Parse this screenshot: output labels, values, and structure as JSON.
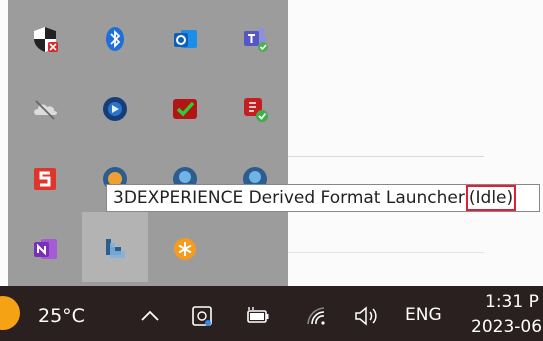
{
  "tooltip": {
    "app_name": "3DEXPERIENCE Derived Format Launcher",
    "status": "(Idle)"
  },
  "flyout_icons": [
    "windows-security-icon",
    "bluetooth-icon",
    "outlook-icon",
    "teams-icon",
    "onedrive-icon",
    "app-sphere-icon",
    "antivirus-shield-icon",
    "sw-check-icon",
    "solidworks-s-icon",
    "launcher-sphere-icon-1",
    "launcher-sphere-icon-2",
    "launcher-sphere-icon-3",
    "onenote-icon",
    "derived-format-launcher-icon",
    "orange-asterisk-icon"
  ],
  "taskbar": {
    "temperature": "25°C",
    "language": "ENG",
    "time": "1:31 P",
    "date": "2023-06"
  },
  "colors": {
    "taskbar_bg": "#2b2020",
    "flyout_bg": "#9c9c9c",
    "highlight_box": "#e0203a"
  }
}
